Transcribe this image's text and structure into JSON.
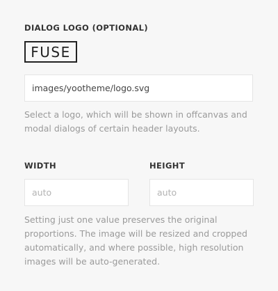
{
  "logo_section": {
    "label": "DIALOG LOGO (OPTIONAL)",
    "logo_text": "FUSE",
    "path_value": "images/yootheme/logo.svg",
    "help": "Select a logo, which will be shown in offcanvas and modal dialogs of certain header layouts."
  },
  "size_section": {
    "width_label": "WIDTH",
    "height_label": "HEIGHT",
    "width_placeholder": "auto",
    "height_placeholder": "auto",
    "help": "Setting just one value preserves the original proportions. The image will be resized and cropped automatically, and where possible, high resolution images will be auto-generated."
  },
  "colors": {
    "background": "#f7f7f7",
    "label": "#333333",
    "help_text": "#9a9a9a",
    "input_border": "#e5e5e5"
  }
}
